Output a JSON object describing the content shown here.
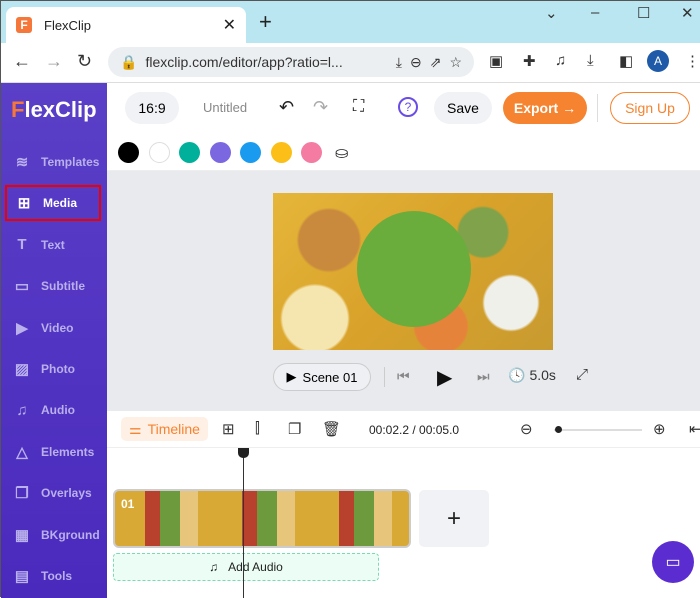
{
  "browser": {
    "tab_title": "FlexClip",
    "url": "flexclip.com/editor/app?ratio=l...",
    "avatar": "A"
  },
  "app": {
    "logo": "FlexClip",
    "ratio": "16:9",
    "title": "Untitled",
    "save": "Save",
    "export": "Export →",
    "signup": "Sign Up"
  },
  "sidebar": {
    "items": [
      {
        "label": "Templates",
        "icon": "layers-icon"
      },
      {
        "label": "Media",
        "icon": "folder-plus-icon"
      },
      {
        "label": "Text",
        "icon": "text-icon"
      },
      {
        "label": "Subtitle",
        "icon": "subtitle-icon"
      },
      {
        "label": "Video",
        "icon": "video-icon"
      },
      {
        "label": "Photo",
        "icon": "photo-icon"
      },
      {
        "label": "Audio",
        "icon": "music-icon"
      },
      {
        "label": "Elements",
        "icon": "elements-icon"
      },
      {
        "label": "Overlays",
        "icon": "overlays-icon"
      },
      {
        "label": "BKground",
        "icon": "background-icon"
      },
      {
        "label": "Tools",
        "icon": "toolbox-icon"
      }
    ],
    "active": "Media"
  },
  "colors": [
    "#000000",
    "#ffffff",
    "#00b09b",
    "#7b68e0",
    "#1a9bef",
    "#fbbf17",
    "#f47ba1"
  ],
  "player": {
    "scene": "Scene 01",
    "duration": "5.0s"
  },
  "timeline": {
    "label": "Timeline",
    "time": "00:02.2 / 00:05.0",
    "clip_number": "01",
    "add_audio": "Add Audio",
    "zoom_level": 0.05
  }
}
